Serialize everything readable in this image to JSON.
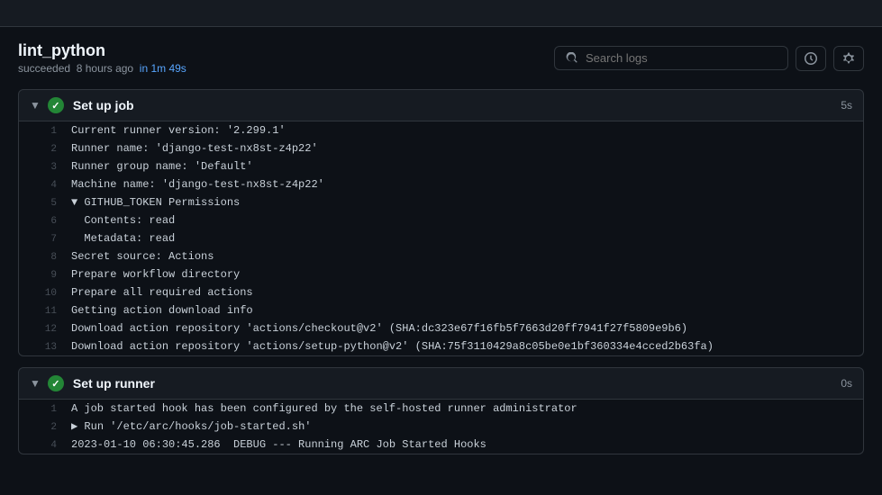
{
  "topbar": {},
  "header": {
    "title": "lint_python",
    "meta_prefix": "succeeded",
    "meta_time": "8 hours ago",
    "meta_duration": "in 1m 49s",
    "search_placeholder": "Search logs"
  },
  "controls": {
    "refresh_label": "refresh",
    "settings_label": "settings"
  },
  "sections": [
    {
      "id": "setup-job",
      "title": "Set up job",
      "duration": "5s",
      "expanded": true,
      "logs": [
        {
          "line": 1,
          "text": "Current runner version: '2.299.1'"
        },
        {
          "line": 2,
          "text": "Runner name: 'django-test-nx8st-z4p22'"
        },
        {
          "line": 3,
          "text": "Runner group name: 'Default'"
        },
        {
          "line": 4,
          "text": "Machine name: 'django-test-nx8st-z4p22'"
        },
        {
          "line": 5,
          "text": "▼ GITHUB_TOKEN Permissions"
        },
        {
          "line": 6,
          "text": "  Contents: read"
        },
        {
          "line": 7,
          "text": "  Metadata: read"
        },
        {
          "line": 8,
          "text": "Secret source: Actions"
        },
        {
          "line": 9,
          "text": "Prepare workflow directory"
        },
        {
          "line": 10,
          "text": "Prepare all required actions"
        },
        {
          "line": 11,
          "text": "Getting action download info"
        },
        {
          "line": 12,
          "text": "Download action repository 'actions/checkout@v2' (SHA:dc323e67f16fb5f7663d20ff7941f27f5809e9b6)"
        },
        {
          "line": 13,
          "text": "Download action repository 'actions/setup-python@v2' (SHA:75f3110429a8c05be0e1bf360334e4cced2b63fa)"
        }
      ]
    },
    {
      "id": "setup-runner",
      "title": "Set up runner",
      "duration": "0s",
      "expanded": true,
      "logs": [
        {
          "line": 1,
          "text": "A job started hook has been configured by the self-hosted runner administrator"
        },
        {
          "line": 2,
          "text": "▶ Run '/etc/arc/hooks/job-started.sh'"
        },
        {
          "line": 4,
          "text": "2023-01-10 06:30:45.286  DEBUG --- Running ARC Job Started Hooks"
        }
      ]
    }
  ]
}
